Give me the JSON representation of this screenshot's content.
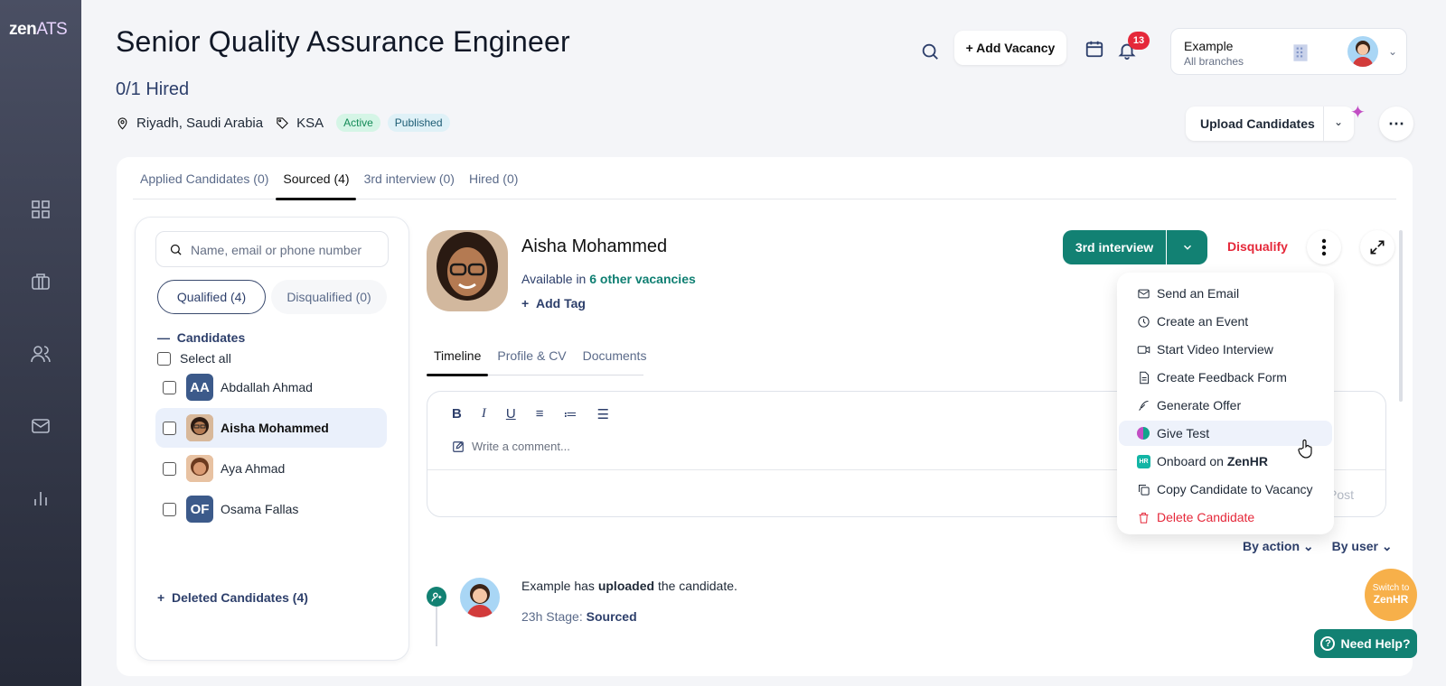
{
  "brand": {
    "logo_main": "zen",
    "logo_sub": "ATS"
  },
  "sidebar": {
    "icons": [
      "dashboard-icon",
      "briefcase-icon",
      "people-icon",
      "mail-icon",
      "chart-icon"
    ]
  },
  "header": {
    "title": "Senior Quality Assurance Engineer",
    "hired": "0/1 Hired",
    "location": "Riyadh, Saudi Arabia",
    "tag": "KSA",
    "status_active": "Active",
    "status_published": "Published",
    "add_vacancy": "+ Add Vacancy",
    "notifications": "13",
    "account_name": "Example",
    "account_branch": "All branches",
    "upload": "Upload Candidates"
  },
  "tabs": [
    {
      "label": "Applied Candidates (0)"
    },
    {
      "label": "Sourced (4)"
    },
    {
      "label": "3rd interview (0)"
    },
    {
      "label": "Hired (0)"
    }
  ],
  "left_panel": {
    "search_placeholder": "Name, email or phone number",
    "qualified": "Qualified (4)",
    "disqualified": "Disqualified (0)",
    "candidates_heading": "Candidates",
    "select_all": "Select all",
    "rows": [
      {
        "initials": "AA",
        "name": "Abdallah Ahmad"
      },
      {
        "initials": "",
        "name": "Aisha Mohammed"
      },
      {
        "initials": "",
        "name": "Aya Ahmad"
      },
      {
        "initials": "OF",
        "name": "Osama Fallas"
      }
    ],
    "deleted": "Deleted Candidates (4)"
  },
  "candidate": {
    "name": "Aisha Mohammed",
    "available_prefix": "Available in",
    "available_link": "6 other vacancies",
    "add_tag": "Add Tag",
    "stage_button": "3rd interview",
    "disqualify": "Disqualify",
    "tabs": [
      "Timeline",
      "Profile & CV",
      "Documents"
    ],
    "comment_placeholder": "Write a comment...",
    "post": "Post",
    "filter_action": "By action",
    "filter_user": "By user",
    "tl_prefix": "Example has ",
    "tl_bold": "uploaded",
    "tl_suffix": " the candidate.",
    "tl_time": "23h Stage:",
    "tl_stage": "Sourced"
  },
  "menu": {
    "items": [
      {
        "label": "Send an Email",
        "icon": "mail-icon"
      },
      {
        "label": "Create an Event",
        "icon": "clock-icon"
      },
      {
        "label": "Start Video Interview",
        "icon": "video-icon"
      },
      {
        "label": "Create Feedback Form",
        "icon": "form-icon"
      },
      {
        "label": "Generate Offer",
        "icon": "pen-icon"
      },
      {
        "label": "Give Test",
        "icon": "test-icon"
      },
      {
        "label": "Onboard on ",
        "bold": "ZenHR",
        "icon": "zenhr-icon"
      },
      {
        "label": "Copy Candidate to Vacancy",
        "icon": "copy-icon"
      },
      {
        "label": "Delete Candidate",
        "icon": "trash-icon"
      }
    ]
  },
  "widgets": {
    "switch_line1": "Switch to",
    "switch_line2": "ZenHR",
    "help": "Need Help?"
  },
  "colors": {
    "primary": "#128173",
    "danger": "#e5283a",
    "navy": "#2d3f6b"
  }
}
